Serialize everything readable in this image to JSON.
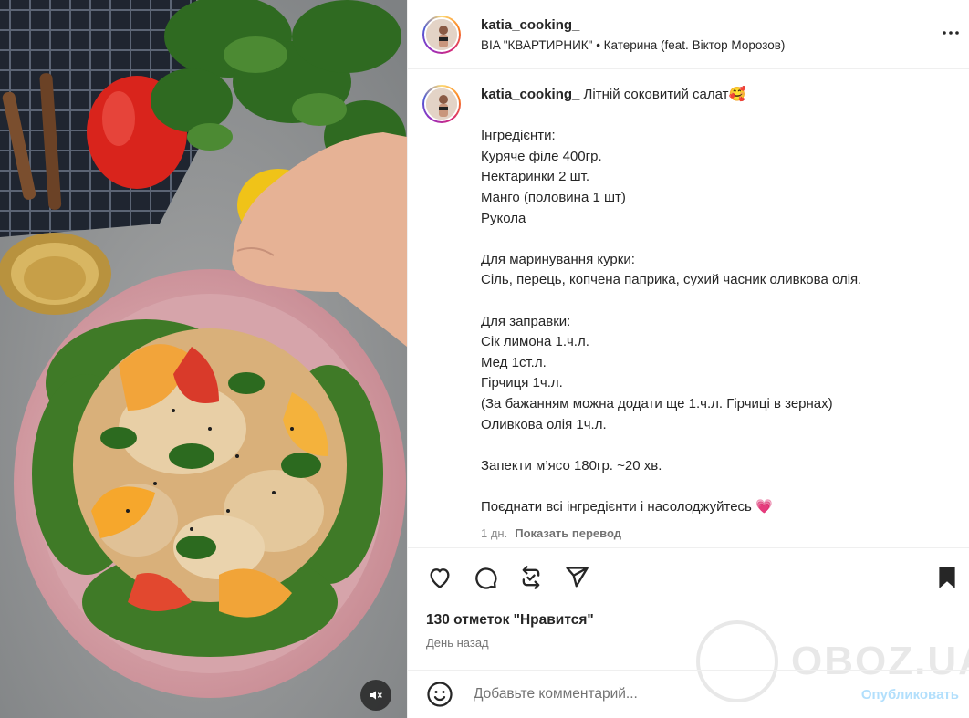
{
  "post": {
    "username": "katia_cooking_",
    "audio": "BIA \"КВАРТИРНИК\" • Катерина (feat. Віктор Морозов)",
    "caption_username": "katia_cooking_",
    "caption_title": " Літній соковитий салат🥰",
    "caption_lines": [
      "",
      "Інгредієнти:",
      "Куряче філе 400гр.",
      "Нектаринки 2 шт.",
      "Манго (половина 1 шт)",
      "Рукола",
      "",
      "Для маринування курки:",
      "Сіль, перець, копчена паприка, сухий часник оливкова олія.",
      "",
      "Для заправки:",
      "Сік лимона 1.ч.л.",
      "Мед 1ст.л.",
      "Гірчиця 1ч.л.",
      "(За бажанням можна додати ще 1.ч.л. Гірчиці в зернах)",
      "Оливкова олія 1ч.л.",
      "",
      "Запекти м’ясо 180гр. ~20 хв.",
      "",
      "Поєднати всі інгредієнти і насолоджуйтесь 💗"
    ],
    "caption_age": "1 дн.",
    "translate_label": "Показать перевод",
    "likes": "130 отметок \"Нравится\"",
    "date": "День назад"
  },
  "comment": {
    "placeholder": "Добавьте комментарий...",
    "publish_label": "Опубликовать"
  },
  "watermark": {
    "text": "OBOZ.UA"
  },
  "icons": [
    "more-options-icon",
    "heart-icon",
    "comment-icon",
    "repost-icon",
    "share-icon",
    "bookmark-icon",
    "emoji-icon",
    "muted-speaker-icon"
  ]
}
